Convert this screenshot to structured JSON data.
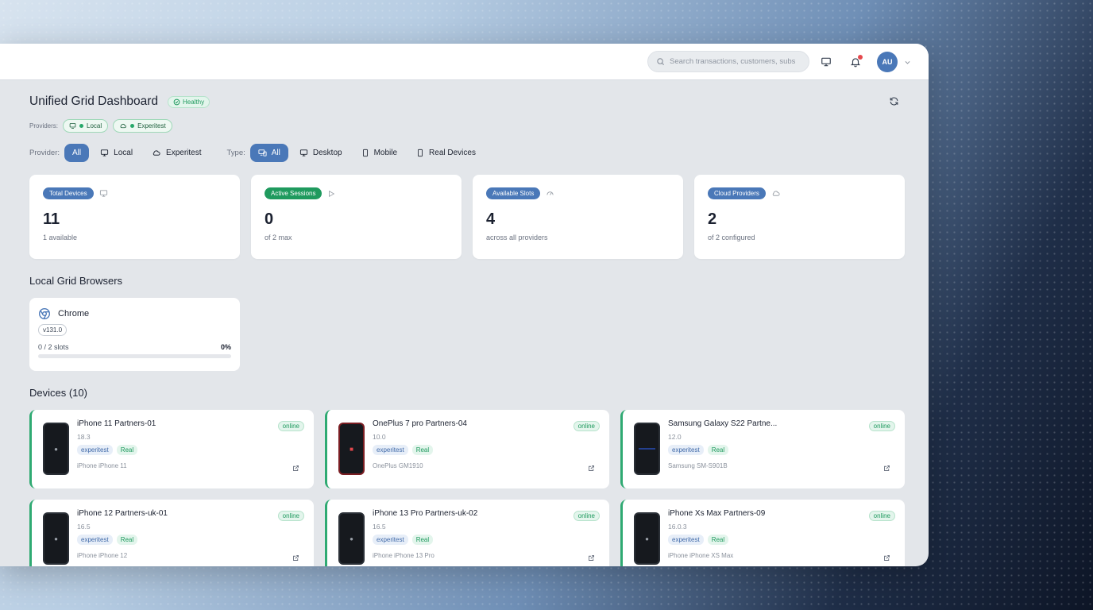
{
  "search": {
    "placeholder": "Search transactions, customers, subs"
  },
  "header": {
    "avatar_initials": "AU"
  },
  "page": {
    "title": "Unified Grid Dashboard",
    "status": "Healthy"
  },
  "providers": {
    "label": "Providers:",
    "chips": [
      {
        "label": "Local",
        "icon": "monitor-icon"
      },
      {
        "label": "Experitest",
        "icon": "cloud-icon"
      }
    ]
  },
  "filters": {
    "provider_label": "Provider:",
    "provider_options": [
      "All",
      "Local",
      "Experitest"
    ],
    "provider_selected": "All",
    "type_label": "Type:",
    "type_options": [
      "All",
      "Desktop",
      "Mobile",
      "Real Devices"
    ],
    "type_selected": "All"
  },
  "stats": [
    {
      "label": "Total Devices",
      "value": "11",
      "sub": "1 available",
      "icon": "monitor-icon",
      "color": "#4a78b8"
    },
    {
      "label": "Active Sessions",
      "value": "0",
      "sub": "of 2 max",
      "icon": "play-icon",
      "color": "#1f9a5e"
    },
    {
      "label": "Available Slots",
      "value": "4",
      "sub": "across all providers",
      "icon": "gauge-icon",
      "color": "#4a78b8"
    },
    {
      "label": "Cloud Providers",
      "value": "2",
      "sub": "of 2 configured",
      "icon": "cloud-icon",
      "color": "#4a78b8"
    }
  ],
  "local_grid": {
    "title": "Local Grid Browsers",
    "browsers": [
      {
        "name": "Chrome",
        "version": "v131.0",
        "slots": "0 / 2 slots",
        "percent_label": "0%",
        "usage": 0
      }
    ]
  },
  "devices": {
    "title": "Devices (10)",
    "items": [
      {
        "name": "iPhone 11 Partners-01",
        "version": "18.3",
        "provider": "experitest",
        "kind": "Real",
        "model": "iPhone iPhone 11",
        "status": "online"
      },
      {
        "name": "OnePlus 7 pro Partners-04",
        "version": "10.0",
        "provider": "experitest",
        "kind": "Real",
        "model": "OnePlus GM1910",
        "status": "online"
      },
      {
        "name": "Samsung Galaxy S22 Partne...",
        "version": "12.0",
        "provider": "experitest",
        "kind": "Real",
        "model": "Samsung SM-S901B",
        "status": "online"
      },
      {
        "name": "iPhone 12 Partners-uk-01",
        "version": "16.5",
        "provider": "experitest",
        "kind": "Real",
        "model": "iPhone iPhone 12",
        "status": "online"
      },
      {
        "name": "iPhone 13 Pro Partners-uk-02",
        "version": "16.5",
        "provider": "experitest",
        "kind": "Real",
        "model": "iPhone iPhone 13 Pro",
        "status": "online"
      },
      {
        "name": "iPhone Xs Max Partners-09",
        "version": "16.0.3",
        "provider": "experitest",
        "kind": "Real",
        "model": "iPhone iPhone XS Max",
        "status": "online"
      }
    ]
  }
}
